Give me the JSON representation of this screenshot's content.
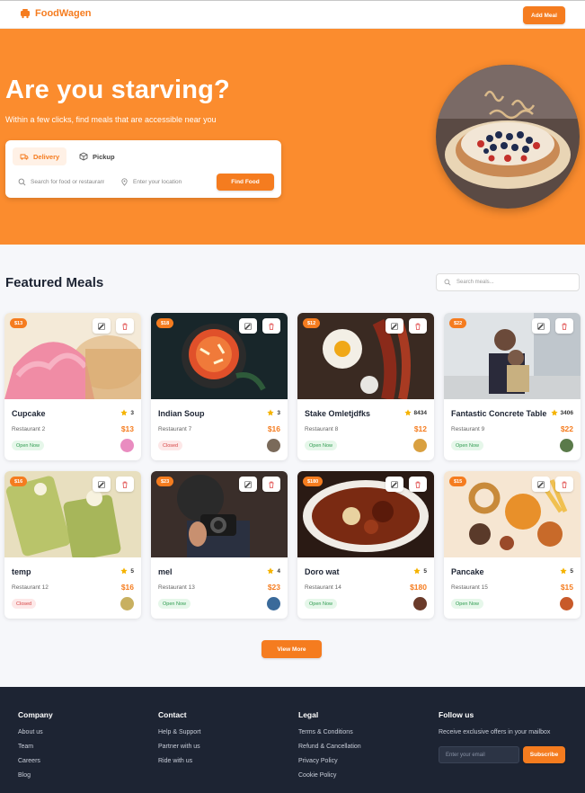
{
  "header": {
    "brand": "FoodWagen",
    "add_meal_label": "Add Meal"
  },
  "hero": {
    "title": "Are you starving?",
    "subtitle": "Within a few clicks, find meals that are accessible near you",
    "tabs": [
      {
        "label": "Delivery",
        "icon": "truck-icon",
        "active": true
      },
      {
        "label": "Pickup",
        "icon": "box-icon",
        "active": false
      }
    ],
    "food_placeholder": "Search for food or restaurants",
    "location_placeholder": "Enter your location",
    "find_label": "Find Food",
    "image_alt": "birthday-cake-image"
  },
  "featured": {
    "title": "Featured Meals",
    "search_placeholder": "Search meals...",
    "view_more_label": "View More",
    "meals": [
      {
        "name": "Cupcake",
        "restaurant": "Restaurant 2",
        "price": "$13",
        "badge": "$13",
        "rating": "3",
        "status": "Open Now",
        "open": true,
        "image": "cupcake"
      },
      {
        "name": "Indian Soup",
        "restaurant": "Restaurant 7",
        "price": "$16",
        "badge": "$18",
        "rating": "3",
        "status": "Closed",
        "open": false,
        "image": "soup"
      },
      {
        "name": "Stake Omletjdfks",
        "restaurant": "Restaurant 8",
        "price": "$12",
        "badge": "$12",
        "rating": "8434",
        "status": "Open Now",
        "open": true,
        "image": "steak"
      },
      {
        "name": "Fantastic Concrete Table",
        "restaurant": "Restaurant 9",
        "price": "$22",
        "badge": "$22",
        "rating": "3406",
        "status": "Open Now",
        "open": true,
        "image": "street"
      },
      {
        "name": "temp",
        "restaurant": "Restaurant 12",
        "price": "$16",
        "badge": "$16",
        "rating": "5",
        "status": "Closed",
        "open": false,
        "image": "drinks"
      },
      {
        "name": "mel",
        "restaurant": "Restaurant 13",
        "price": "$23",
        "badge": "$23",
        "rating": "4",
        "status": "Open Now",
        "open": true,
        "image": "camera"
      },
      {
        "name": "Doro wat",
        "restaurant": "Restaurant 14",
        "price": "$180",
        "badge": "$180",
        "rating": "5",
        "status": "Open Now",
        "open": true,
        "image": "stew"
      },
      {
        "name": "Pancake",
        "restaurant": "Restaurant 15",
        "price": "$15",
        "badge": "$15",
        "rating": "5",
        "status": "Open Now",
        "open": true,
        "image": "junkfood"
      }
    ]
  },
  "footer": {
    "company": {
      "title": "Company",
      "links": [
        "About us",
        "Team",
        "Careers",
        "Blog"
      ]
    },
    "contact": {
      "title": "Contact",
      "links": [
        "Help & Support",
        "Partner with us",
        "Ride with us"
      ]
    },
    "legal": {
      "title": "Legal",
      "links": [
        "Terms & Conditions",
        "Refund & Cancellation",
        "Privacy Policy",
        "Cookie Policy"
      ]
    },
    "follow": {
      "title": "Follow us",
      "text": "Receive exclusive offers in your mailbox",
      "email_placeholder": "Enter your email",
      "subscribe_label": "Subscribe"
    }
  },
  "colors": {
    "brand": "#f57c1f",
    "hero": "#fb8c2e",
    "footer": "#1d2433"
  }
}
